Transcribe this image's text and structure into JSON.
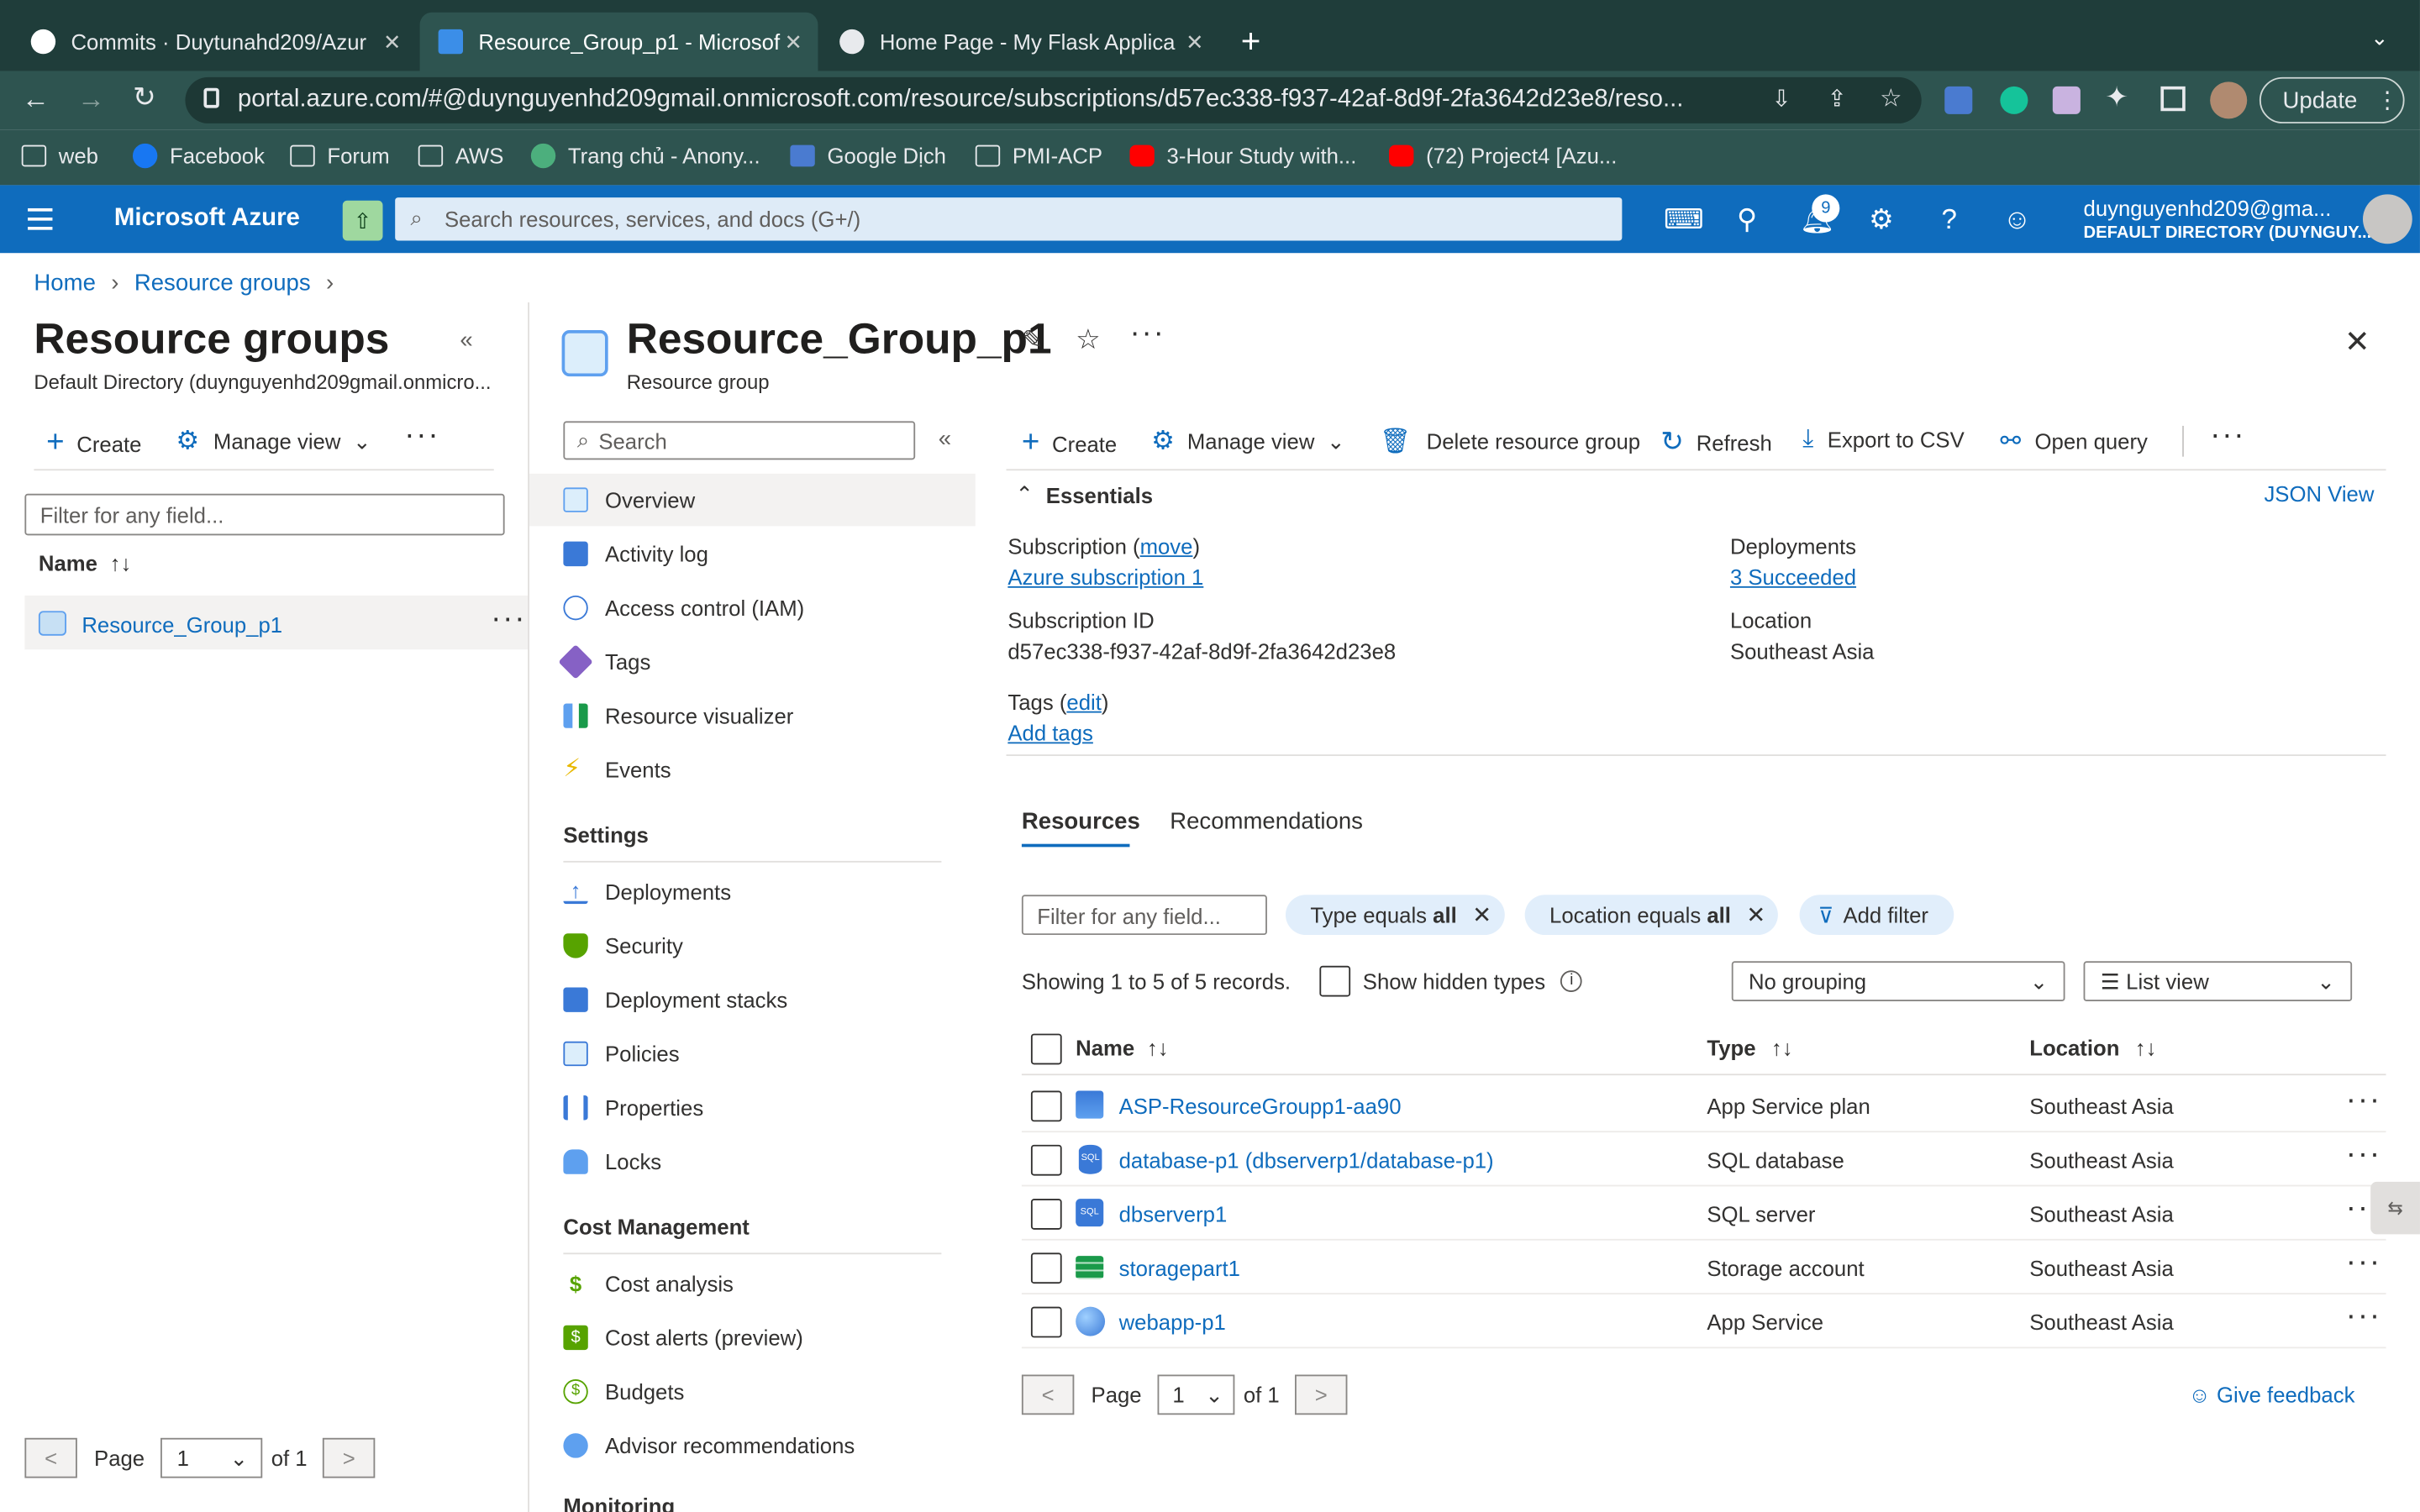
{
  "browser": {
    "tabs": [
      {
        "label": "Commits · Duytunahd209/Azur"
      },
      {
        "label": "Resource_Group_p1 - Microsof"
      },
      {
        "label": "Home Page - My Flask Applica"
      }
    ],
    "url": "portal.azure.com/#@duynguyenhd209gmail.onmicrosoft.com/resource/subscriptions/d57ec338-f937-42af-8d9f-2fa3642d23e8/reso...",
    "update_label": "Update",
    "bookmarks": [
      "web",
      "Facebook",
      "Forum",
      "AWS",
      "Trang chủ - Anony...",
      "Google Dịch",
      "PMI-ACP",
      "3-Hour Study with...",
      "(72) Project4 [Azu..."
    ]
  },
  "azure": {
    "brand": "Microsoft Azure",
    "search_placeholder": "Search resources, services, and docs (G+/)",
    "notif_count": "9",
    "user": "duynguyenhd209@gma...",
    "directory": "DEFAULT DIRECTORY (DUYNGUY..."
  },
  "breadcrumb": [
    "Home",
    "Resource groups"
  ],
  "left": {
    "title": "Resource groups",
    "subtitle": "Default Directory (duynguyenhd209gmail.onmicro...",
    "create": "Create",
    "manage_view": "Manage view",
    "filter_placeholder": "Filter for any field...",
    "name_col": "Name",
    "item": "Resource_Group_p1",
    "page_label": "Page",
    "page_value": "1",
    "of": "of 1"
  },
  "rg": {
    "title": "Resource_Group_p1",
    "subtitle": "Resource group",
    "search_placeholder": "Search",
    "menu": [
      "Overview",
      "Activity log",
      "Access control (IAM)",
      "Tags",
      "Resource visualizer",
      "Events"
    ],
    "settings_header": "Settings",
    "settings": [
      "Deployments",
      "Security",
      "Deployment stacks",
      "Policies",
      "Properties",
      "Locks"
    ],
    "cost_header": "Cost Management",
    "cost": [
      "Cost analysis",
      "Cost alerts (preview)",
      "Budgets",
      "Advisor recommendations"
    ],
    "monitoring_header": "Monitoring"
  },
  "toolbar": {
    "create": "Create",
    "manage_view": "Manage view",
    "delete": "Delete resource group",
    "refresh": "Refresh",
    "export": "Export to CSV",
    "open_query": "Open query"
  },
  "essentials": {
    "title": "Essentials",
    "json_view": "JSON View",
    "subscription_label": "Subscription (",
    "move": "move",
    "subscription_value": "Azure subscription 1",
    "subid_label": "Subscription ID",
    "subid_value": "d57ec338-f937-42af-8d9f-2fa3642d23e8",
    "tags_label": "Tags (",
    "edit": "edit",
    "add_tags": "Add tags",
    "deployments_label": "Deployments",
    "deployments_value": "3 Succeeded",
    "location_label": "Location",
    "location_value": "Southeast Asia"
  },
  "resources": {
    "tab_resources": "Resources",
    "tab_recommendations": "Recommendations",
    "filter_placeholder": "Filter for any field...",
    "pill_type": "Type equals ",
    "pill_type_bold": "all",
    "pill_location": "Location equals ",
    "pill_location_bold": "all",
    "add_filter": "Add filter",
    "showing": "Showing 1 to 5 of 5 records.",
    "show_hidden": "Show hidden types",
    "grouping": "No grouping",
    "view": "List view",
    "col_name": "Name",
    "col_type": "Type",
    "col_location": "Location",
    "rows": [
      {
        "name": "ASP-ResourceGroupp1-aa90",
        "type": "App Service plan",
        "location": "Southeast Asia"
      },
      {
        "name": "database-p1 (dbserverp1/database-p1)",
        "type": "SQL database",
        "location": "Southeast Asia"
      },
      {
        "name": "dbserverp1",
        "type": "SQL server",
        "location": "Southeast Asia"
      },
      {
        "name": "storagepart1",
        "type": "Storage account",
        "location": "Southeast Asia"
      },
      {
        "name": "webapp-p1",
        "type": "App Service",
        "location": "Southeast Asia"
      }
    ],
    "page_label": "Page",
    "page_value": "1",
    "of": "of 1",
    "feedback": "Give feedback"
  }
}
